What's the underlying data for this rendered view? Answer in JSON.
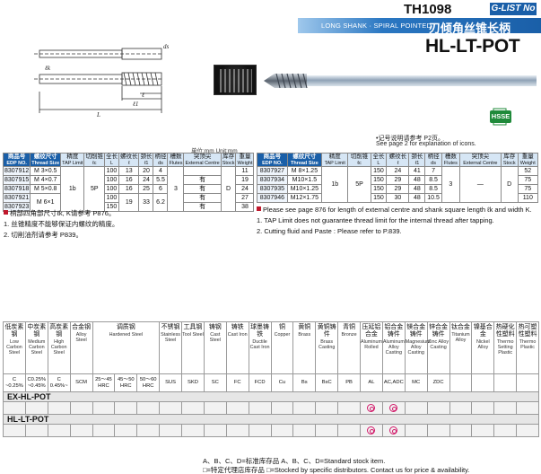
{
  "header": {
    "code": "TH1098",
    "badge": "G-LIST No",
    "subtitle": "LONG SHANK · SPIRAL POINTED",
    "title_cn": "刃倾角丝锥长柄",
    "model": "HL-LT-POT"
  },
  "icons": {
    "license": "license-document-icon",
    "hsse": "HSSE"
  },
  "unit": "单位:mm    Unit:mm",
  "notes_right_top": [
    "•记号说明请参考 P2页。",
    "See page 2 for explanation of icons."
  ],
  "table_headers": {
    "edp_cn": "商品号",
    "edp_en": "EDP NO.",
    "size_cn": "螺纹尺寸",
    "size_en": "Thread Size",
    "limit_cn": "精度",
    "limit_en": "TAP Limit",
    "chamfer_cn": "切削锥",
    "chamfer_en": "ℓc",
    "L_cn": "全长",
    "L_en": "L",
    "l_cn": "螺纹长",
    "l_en": "ℓ",
    "l1_cn": "颈长",
    "l1_en": "ℓ1",
    "ds_cn": "柄径",
    "ds_en": "ds",
    "flutes_cn": "槽数",
    "flutes_en": "Flutes",
    "ext_cn": "突顶尖",
    "ext_en": "External Centre",
    "stock_cn": "库存",
    "stock_en": "Stock",
    "weight_cn": "重量",
    "weight_en": "Weight"
  },
  "left_table": {
    "rows": [
      {
        "edp": "8307912",
        "size": "M 3×0.5",
        "L": "100",
        "l": "13",
        "l1": "20",
        "ds": "4",
        "ext": "",
        "weight": "11"
      },
      {
        "edp": "8307915",
        "size": "M 4×0.7",
        "L": "100",
        "l": "16",
        "l1": "24",
        "ds": "5.5",
        "ext": "有",
        "weight": "19"
      },
      {
        "edp": "8307918",
        "size": "M 5×0.8",
        "L": "100",
        "l": "16",
        "l1": "25",
        "ds": "6",
        "ext": "有",
        "weight": "24"
      },
      {
        "edp": "8307921",
        "size": "M 6×1",
        "L": "100",
        "l": "19",
        "l1": "33",
        "ds": "6.2",
        "ext": "有",
        "weight": "27"
      },
      {
        "edp": "8307923",
        "size": "",
        "L": "150",
        "l": "",
        "l1": "",
        "ds": "",
        "ext": "有",
        "weight": "38"
      }
    ],
    "limit": "1b",
    "chamfer": "5P",
    "flutes": "3",
    "stock": "D"
  },
  "right_table": {
    "rows": [
      {
        "edp": "8307927",
        "size": "M 8×1.25",
        "L": "150",
        "l": "24",
        "l1": "41",
        "ds": "7",
        "weight": "52"
      },
      {
        "edp": "8307934",
        "size": "M10×1.5",
        "L": "150",
        "l": "29",
        "l1": "48",
        "ds": "8.5",
        "weight": "75"
      },
      {
        "edp": "8307935",
        "size": "M10×1.25",
        "L": "150",
        "l": "29",
        "l1": "48",
        "ds": "8.5",
        "weight": "75"
      },
      {
        "edp": "8307946",
        "size": "M12×1.75",
        "L": "150",
        "l": "30",
        "l1": "48",
        "ds": "10.5",
        "weight": "110"
      }
    ],
    "limit": "1b",
    "chamfer": "5P",
    "flutes": "3",
    "ext": "—",
    "stock": "D"
  },
  "notes_left": [
    "柄部四角部尺寸ℓk, K请参考 P876。",
    "1. 丝锥精度不能够保证内螺纹的精度。",
    "2. 切削油剂请参考 P839。"
  ],
  "notes_right": [
    "Please see page 876 for length of external centre and shank square length ℓk and width K.",
    "1. TAP Limit does not guarantee thread limit for the internal thread after tapping.",
    "2. Cutting fluid and Paste : Please refer to P.839."
  ],
  "materials": [
    {
      "cn": "低炭素钢",
      "en": "Low Carbon Steel",
      "abbr": "C ~0.25%"
    },
    {
      "cn": "中炭素钢",
      "en": "Medium Carbon Steel",
      "abbr": "C0.25% ~0.45%"
    },
    {
      "cn": "高炭素钢",
      "en": "High Carbon Steel",
      "abbr": "C 0.45%~"
    },
    {
      "cn": "合金钢",
      "en": "Alloy Steel",
      "abbr": "SCM"
    },
    {
      "cn": "调质钢",
      "en": "Hardened Steel",
      "abbr": "25～45 HRC"
    },
    {
      "cn": "",
      "en": "",
      "abbr": "45～50 HRC"
    },
    {
      "cn": "",
      "en": "",
      "abbr": "50～60 HRC"
    },
    {
      "cn": "不锈钢",
      "en": "Stainless Steel",
      "abbr": "SUS"
    },
    {
      "cn": "工具钢",
      "en": "Tool Steel",
      "abbr": "SKD"
    },
    {
      "cn": "铸钢",
      "en": "Cast Steel",
      "abbr": "SC"
    },
    {
      "cn": "铸铁",
      "en": "Cast Iron",
      "abbr": "FC"
    },
    {
      "cn": "球墨铸铁",
      "en": "Ductile Cast Iron",
      "abbr": "FCD"
    },
    {
      "cn": "铜",
      "en": "Copper",
      "abbr": "Cu"
    },
    {
      "cn": "黄铜",
      "en": "Brass",
      "abbr": "Bs"
    },
    {
      "cn": "黄铜铸件",
      "en": "Brass Casting",
      "abbr": "BsC"
    },
    {
      "cn": "青铜",
      "en": "Bronze",
      "abbr": "PB"
    },
    {
      "cn": "压延铝合金",
      "en": "Aluminum Rolled",
      "abbr": "AL"
    },
    {
      "cn": "铝合金铸件",
      "en": "Aluminum Alloy Casting",
      "abbr": "AC,ADC"
    },
    {
      "cn": "镁合金铸件",
      "en": "Magnesium Alloy Casting",
      "abbr": "MC"
    },
    {
      "cn": "锌合金铸件",
      "en": "Zinc Alloy Casting",
      "abbr": "ZDC"
    },
    {
      "cn": "钛合金",
      "en": "Titanium Alloy",
      "abbr": ""
    },
    {
      "cn": "镍基合金",
      "en": "Nickel Alloy",
      "abbr": ""
    },
    {
      "cn": "热硬化性塑料",
      "en": "Thermo Setting Plastic",
      "abbr": ""
    },
    {
      "cn": "热可塑性塑料",
      "en": "Thermo Plastic",
      "abbr": ""
    }
  ],
  "tools": [
    {
      "name": "EX-HL-POT",
      "marks": [
        16,
        17
      ]
    },
    {
      "name": "HL-LT-POT",
      "marks": [
        16,
        17
      ]
    }
  ],
  "colors": {
    "brand_blue": "#1a5fa8",
    "header_light": "#d6e6f5",
    "mark_magenta": "#d21a6a",
    "accent_red": "#c0182c",
    "hsse_green": "#1f8a3a"
  },
  "footer": [
    "A、B、C、D=标准库存品  A、B、C、D=Standard stock item.",
    "□=特定代理店库存品 □=Stocked by specific distributors. Contact us for price & availability."
  ]
}
